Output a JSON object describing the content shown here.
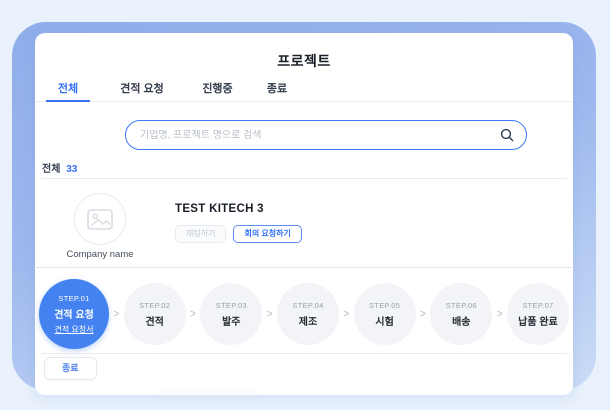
{
  "window": {
    "title": "프로젝트"
  },
  "tabs": {
    "items": [
      {
        "label": "전체",
        "active": true
      },
      {
        "label": "견적 요청",
        "active": false
      },
      {
        "label": "진행중",
        "active": false
      },
      {
        "label": "종료",
        "active": false
      }
    ]
  },
  "search": {
    "placeholder": "기업명, 프로젝트 명으로 검색"
  },
  "summary": {
    "label": "전체",
    "count": "33"
  },
  "project": {
    "name": "TEST KITECH 3",
    "company_label": "Company name",
    "buttons": {
      "chat": "채팅하기",
      "meeting": "회의 요청하기"
    },
    "status_button": "종료"
  },
  "steps": {
    "items": [
      {
        "num": "STEP.01",
        "label": "견적 요청",
        "link": "견적 요청서",
        "active": true
      },
      {
        "num": "STEP.02",
        "label": "견적"
      },
      {
        "num": "STEP.03",
        "label": "발주"
      },
      {
        "num": "STEP.04",
        "label": "제조"
      },
      {
        "num": "STEP.05",
        "label": "시험"
      },
      {
        "num": "STEP.06",
        "label": "배송"
      },
      {
        "num": "STEP.07",
        "label": "납품 완료"
      }
    ]
  },
  "icons": {
    "chevron": ">",
    "search": "magnifier",
    "avatar_placeholder": "image-placeholder"
  },
  "colors": {
    "accent": "#3470f1",
    "step_active": "#4382f0",
    "backdrop_top": "#8fadea",
    "backdrop_bottom": "#cadcf6"
  }
}
